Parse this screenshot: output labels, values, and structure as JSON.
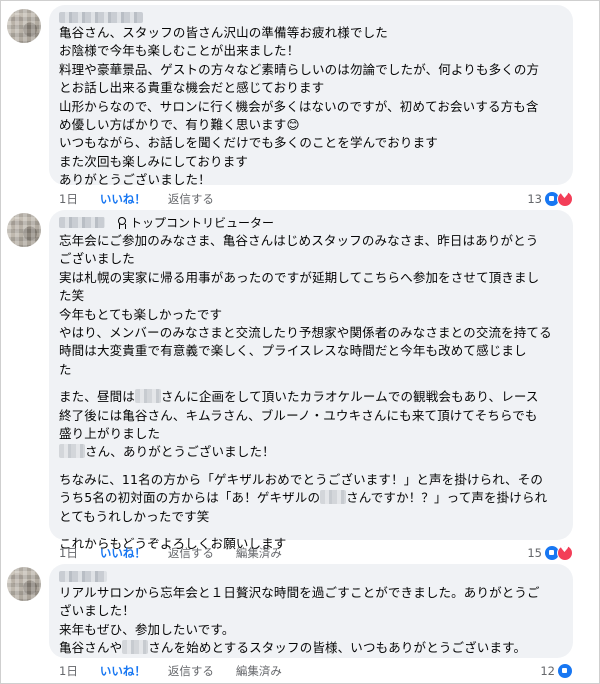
{
  "comments": [
    {
      "lines": [
        "亀谷さん、スタッフの皆さん沢山の準備等お疲れ様でした",
        "お陰様で今年も楽しむことが出来ました！",
        "料理や豪華景品、ゲストの方々など素晴らしいのは勿論でしたが、何よりも多くの方",
        "とお話し出来る貴重な機会だと感じております",
        "山形からなので、サロンに行く機会が多くはないのですが、初めてお会いする方も含",
        "め優しい方ばかりで、有り難く思います😊",
        "いつもながら、お話しを聞くだけでも多くのことを学んでおります",
        "また次回も楽しみにしております",
        "ありがとうございました！"
      ],
      "time": "1日",
      "like_label": "いいね！",
      "reply_label": "返信する",
      "reaction_count": "13",
      "reactions": [
        "like-icon",
        "love-icon"
      ]
    },
    {
      "badge": "トップコントリビューター",
      "para1": [
        "忘年会にご参加のみなさま、亀谷さんはじめスタッフのみなさま、昨日はありがとう",
        "ございました",
        "実は札幌の実家に帰る用事があったのですが延期してこちらへ参加をさせて頂きまし",
        "た笑",
        "今年もとても楽しかったです",
        "やはり、メンバーのみなさまと交流したり予想家や関係者のみなさまとの交流を持てる",
        "時間は大変貴重で有意義で楽しく、プライスレスな時間だと今年も改めて感じまし",
        "た"
      ],
      "para2_line1_a": "また、昼間は",
      "para2_line1_b": "さんに企画をして頂いたカラオケルームでの観戦会もあり、レース",
      "para2_line2": "終了後には亀谷さん、キムラさん、ブルーノ・ユウキさんにも来て頂けてそちらでも",
      "para2_line3": "盛り上がりました",
      "para2_line4": "さん、ありがとうございました！",
      "para3_line1": "ちなみに、11名の方から「ゲキザルおめでとうございます！」と声を掛けられ、その",
      "para3_line2_a": "うち5名の初対面の方からは「あ！ゲキザルの",
      "para3_line2_b": "さんですか！？」って声を掛けられ",
      "para3_line3": "とてもうれしかったです笑",
      "para4": "これからもどうぞよろしくお願いします",
      "time": "1日",
      "like_label": "いいね！",
      "reply_label": "返信する",
      "edited_label": "編集済み",
      "reaction_count": "15",
      "reactions": [
        "like-icon",
        "love-icon"
      ]
    },
    {
      "line1": "リアルサロンから忘年会と１日贅沢な時間を過ごすことができました。ありがとうご",
      "line2": "ざいました！",
      "line3": "来年もぜひ、参加したいです。",
      "line4_a": "亀谷さんや",
      "line4_b": "さんを始めとするスタッフの皆様、いつもありがとうございます。",
      "time": "1日",
      "like_label": "いいね！",
      "reply_label": "返信する",
      "edited_label": "編集済み",
      "reaction_count": "12",
      "reactions": [
        "like-icon"
      ]
    }
  ]
}
